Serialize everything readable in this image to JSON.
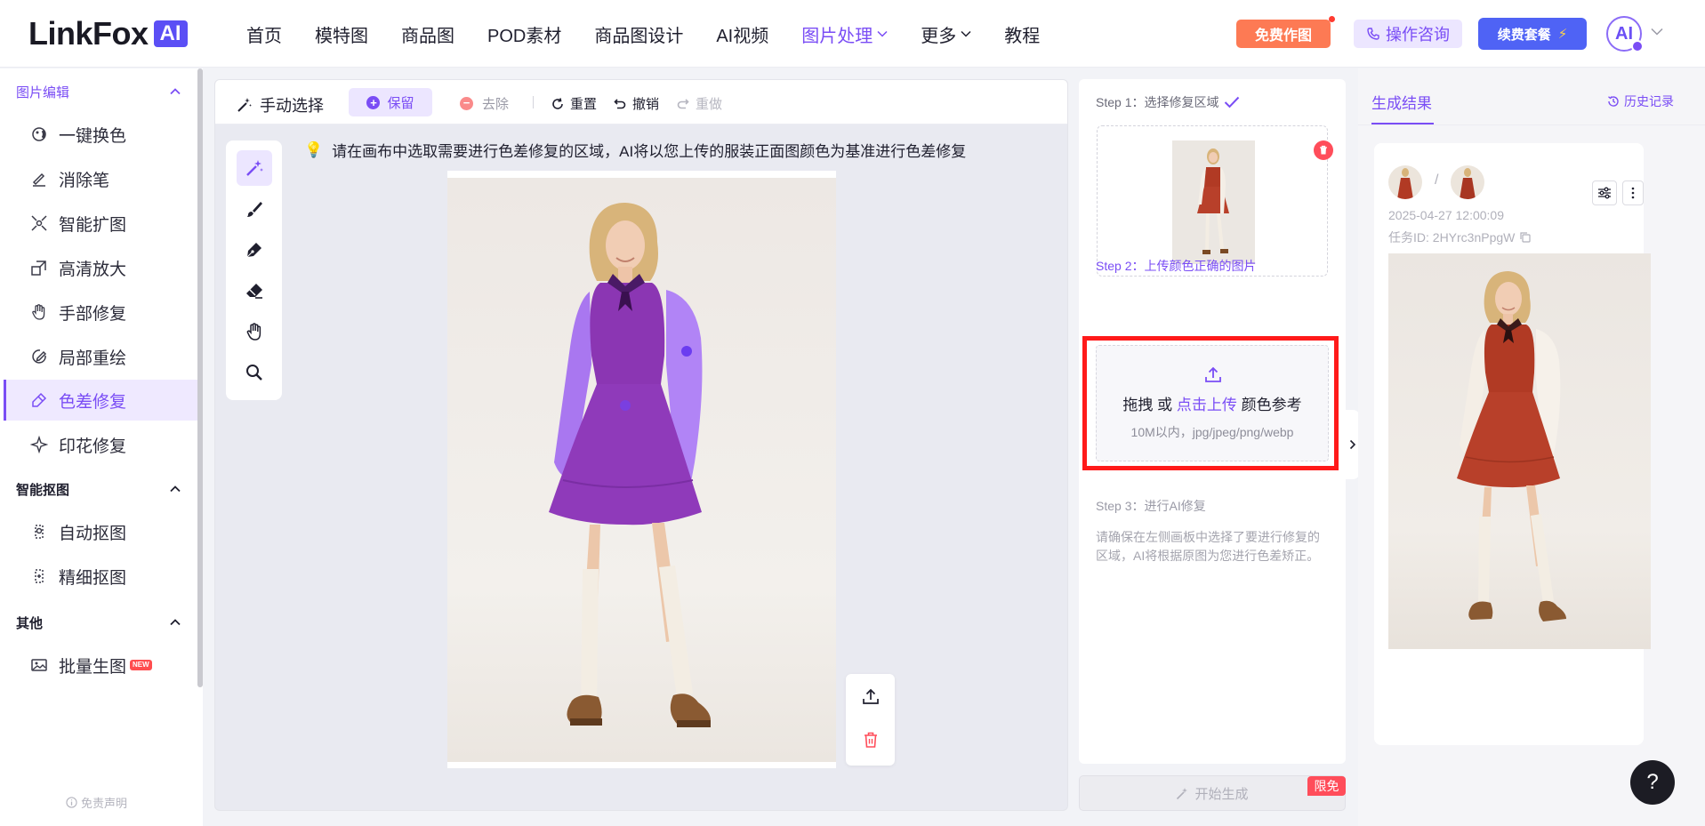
{
  "brand": {
    "logo_text": "LinkFox",
    "logo_badge": "AI"
  },
  "nav": {
    "items": [
      {
        "label": "首页"
      },
      {
        "label": "模特图"
      },
      {
        "label": "商品图"
      },
      {
        "label": "POD素材"
      },
      {
        "label": "商品图设计"
      },
      {
        "label": "AI视频"
      },
      {
        "label": "图片处理"
      },
      {
        "label": "更多"
      },
      {
        "label": "教程"
      }
    ],
    "active": "图片处理",
    "free_button": "免费作图",
    "consult_button": "操作咨询",
    "renew_button": "续费套餐",
    "avatar_text": "AI"
  },
  "sidebar": {
    "groups": [
      {
        "label": "图片编辑",
        "items": [
          "一键换色",
          "消除笔",
          "智能扩图",
          "高清放大",
          "手部修复",
          "局部重绘",
          "色差修复",
          "印花修复"
        ]
      },
      {
        "label": "智能抠图",
        "items": [
          "自动抠图",
          "精细抠图"
        ]
      },
      {
        "label": "其他",
        "items": [
          "批量生图"
        ]
      }
    ],
    "active_item": "色差修复",
    "new_badge": "NEW",
    "disclaimer": "免责声明"
  },
  "toolbar": {
    "mode": "手动选择",
    "keep": "保留",
    "remove": "去除",
    "reset": "重置",
    "undo": "撤销",
    "redo": "重做"
  },
  "canvas": {
    "hint": "请在画布中选取需要进行色差修复的区域，AI将以您上传的服装正面图颜色为基准进行色差修复"
  },
  "steps": {
    "step1": "Step 1：选择修复区域",
    "step2": "Step 2：上传颜色正确的图片",
    "upload_drag": "拖拽 或 ",
    "upload_link": "点击上传",
    "upload_suffix": " 颜色参考",
    "upload_limits": "10M以内，jpg/jpeg/png/webp",
    "step3": "Step 3：进行AI修复",
    "step3_desc": "请确保在左侧画板中选择了要进行修复的区域，AI将根据原图为您进行色差矫正。",
    "generate": "开始生成",
    "limited": "限免"
  },
  "results": {
    "tab": "生成结果",
    "history": "历史记录",
    "date": "2025-04-27 12:00:09",
    "task_id": "任务ID: 2HYrc3nPpgW",
    "separator": "/"
  },
  "help": "?",
  "colors": {
    "accent": "#7a4df5",
    "danger": "#ff4d5a",
    "highlight": "#ff1a1a",
    "orange": "#fd7a54",
    "blue": "#4f63f5"
  }
}
